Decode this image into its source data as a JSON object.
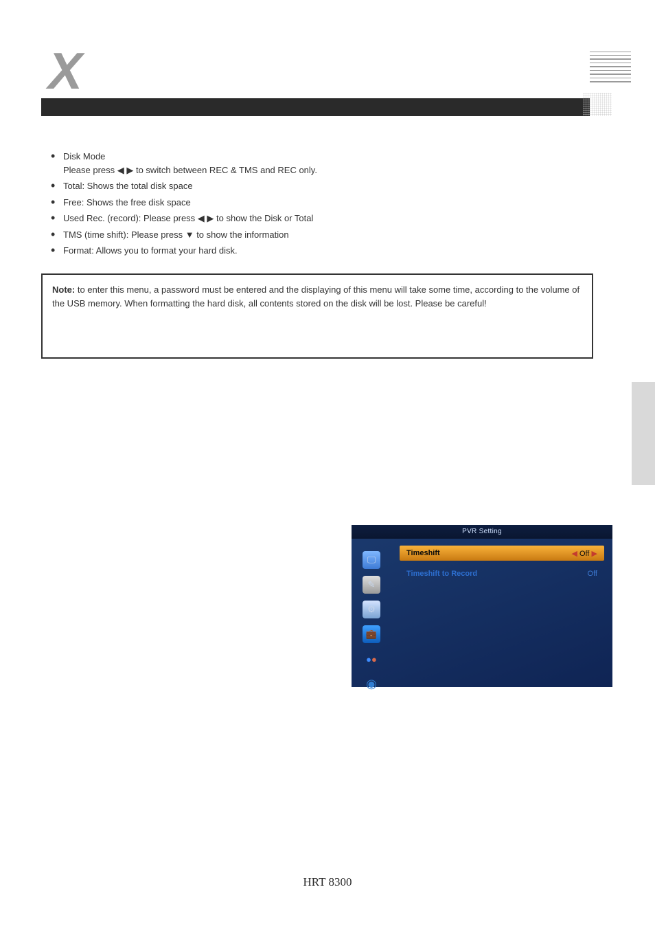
{
  "bullets": {
    "b1_line1": "Disk Mode",
    "b1_line2": "Please press ◀ ▶ to switch between REC & TMS and REC only.",
    "b2": "Total: Shows the total disk space",
    "b3": "Free: Shows the free disk space",
    "b4": "Used Rec. (record): Please press ◀ ▶ to show the Disk or Total",
    "b5": "TMS (time shift): Please press ▼ to show the information",
    "b6": "Format: Allows you to format your hard disk."
  },
  "note": {
    "title": "Note:",
    "body": " to enter this menu, a password must be entered and the displaying of this menu will take some time, according to the volume of the USB memory. When formatting the hard disk, all contents stored on the disk will be lost. Please be careful!"
  },
  "pvr_inset": {
    "title": "PVR Setting",
    "row1_label": "Timeshift",
    "row1_value": "Off",
    "row2_label": "Timeshift to Record",
    "row2_value": "Off"
  },
  "footer": "HRT 8300"
}
